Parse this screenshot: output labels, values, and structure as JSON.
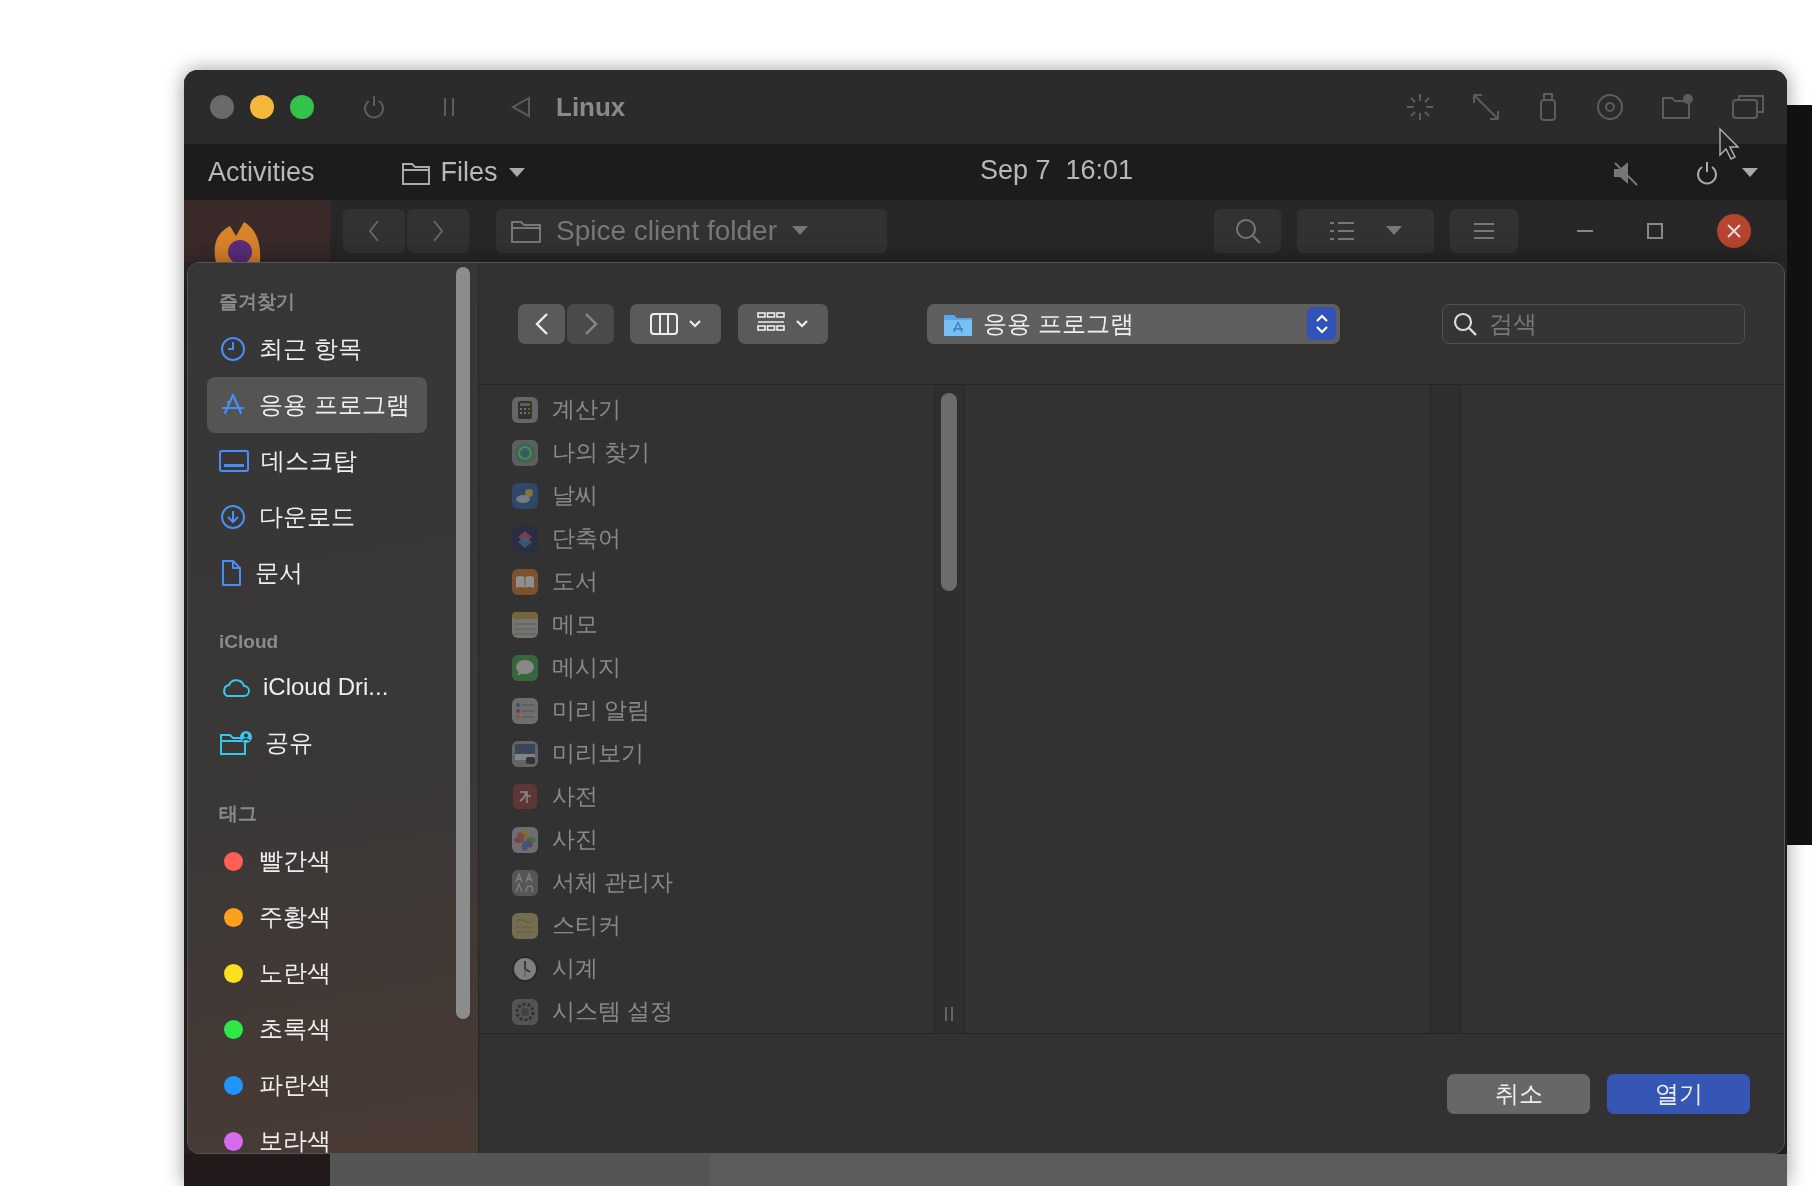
{
  "vm_window": {
    "title": "Linux"
  },
  "top_bar": {
    "activities": "Activities",
    "app_menu": "Files",
    "clock": "Sep 7  16:01"
  },
  "files_window": {
    "location": "Spice client folder"
  },
  "dialog": {
    "sidebar": {
      "sections": [
        {
          "title": "즐겨찾기",
          "items": [
            {
              "label": "최근 항목",
              "selected": false
            },
            {
              "label": "응용 프로그램",
              "selected": true
            },
            {
              "label": "데스크탑",
              "selected": false
            },
            {
              "label": "다운로드",
              "selected": false
            },
            {
              "label": "문서",
              "selected": false
            }
          ]
        },
        {
          "title": "iCloud",
          "items": [
            {
              "label": "iCloud Dri...",
              "selected": false
            },
            {
              "label": "공유",
              "selected": false
            }
          ]
        },
        {
          "title": "태그",
          "items": [
            {
              "label": "빨간색",
              "color": "#ff5f57",
              "selected": false
            },
            {
              "label": "주황색",
              "color": "#ffa01c",
              "selected": false
            },
            {
              "label": "노란색",
              "color": "#ffe01c",
              "selected": false
            },
            {
              "label": "초록색",
              "color": "#2ee84a",
              "selected": false
            },
            {
              "label": "파란색",
              "color": "#1e96ff",
              "selected": false
            },
            {
              "label": "보라색",
              "color": "#d46bf0",
              "selected": false
            }
          ]
        }
      ]
    },
    "toolbar": {
      "location": "응용 프로그램",
      "search": {
        "placeholder": "검색"
      }
    },
    "apps": [
      {
        "label": "계산기",
        "disabled": true
      },
      {
        "label": "나의 찾기",
        "disabled": true
      },
      {
        "label": "날씨",
        "disabled": true
      },
      {
        "label": "단축어",
        "disabled": true
      },
      {
        "label": "도서",
        "disabled": true
      },
      {
        "label": "메모",
        "disabled": true
      },
      {
        "label": "메시지",
        "disabled": true
      },
      {
        "label": "미리 알림",
        "disabled": true
      },
      {
        "label": "미리보기",
        "disabled": true
      },
      {
        "label": "사전",
        "disabled": true
      },
      {
        "label": "사진",
        "disabled": true
      },
      {
        "label": "서체 관리자",
        "disabled": true
      },
      {
        "label": "스티커",
        "disabled": true
      },
      {
        "label": "시계",
        "disabled": true
      },
      {
        "label": "시스템 설정",
        "disabled": true
      }
    ],
    "buttons": [
      {
        "label": "취소",
        "kind": "secondary"
      },
      {
        "label": "열기",
        "kind": "primary"
      }
    ]
  }
}
